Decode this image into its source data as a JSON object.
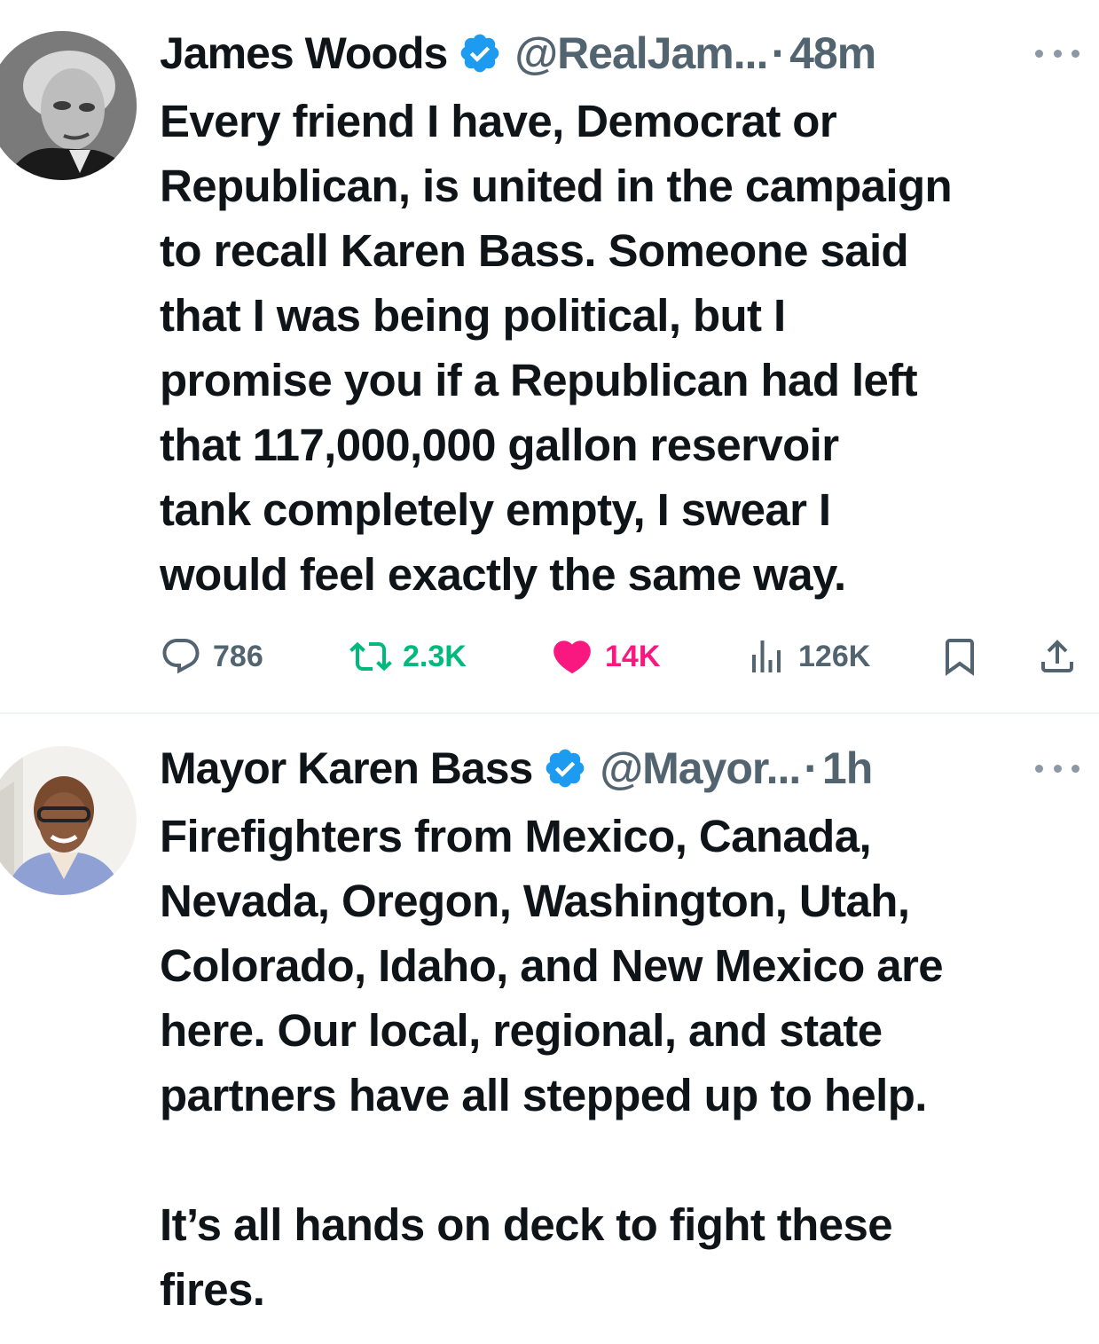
{
  "tweets": [
    {
      "author_name": "James Woods",
      "handle": "@RealJam...",
      "separator": "·",
      "time": "48m",
      "text": "Every friend I have, Democrat or\nRepublican, is united in the campaign\nto recall Karen Bass. Someone said\nthat I was being political, but I\npromise you if a Republican had left\nthat 117,000,000 gallon reservoir\ntank completely empty, I swear I\nwould feel exactly the same way.",
      "stats": {
        "replies": "786",
        "reposts": "2.3K",
        "likes": "14K",
        "views": "126K"
      },
      "liked": true,
      "reposted": true
    },
    {
      "author_name": "Mayor Karen Bass",
      "handle": "@Mayor...",
      "separator": "·",
      "time": "1h",
      "text": "Firefighters from Mexico, Canada,\nNevada, Oregon, Washington, Utah,\nColorado, Idaho, and New Mexico are\nhere. Our local, regional, and state\npartners have all stepped up to help.\n\nIt’s all hands on deck to fight these\nfires."
    }
  ],
  "icons": {
    "verified": "verified-badge-icon",
    "more": "more-options-icon",
    "reply": "reply-icon",
    "repost": "repost-icon",
    "like": "heart-icon",
    "views": "views-icon",
    "bookmark": "bookmark-icon",
    "share": "share-icon"
  },
  "colors": {
    "text": "#0f1419",
    "secondary": "#536471",
    "verified": "#1d9bf0",
    "repost_active": "#00ba7c",
    "like_active": "#f91880",
    "divider": "#eff3f4"
  }
}
